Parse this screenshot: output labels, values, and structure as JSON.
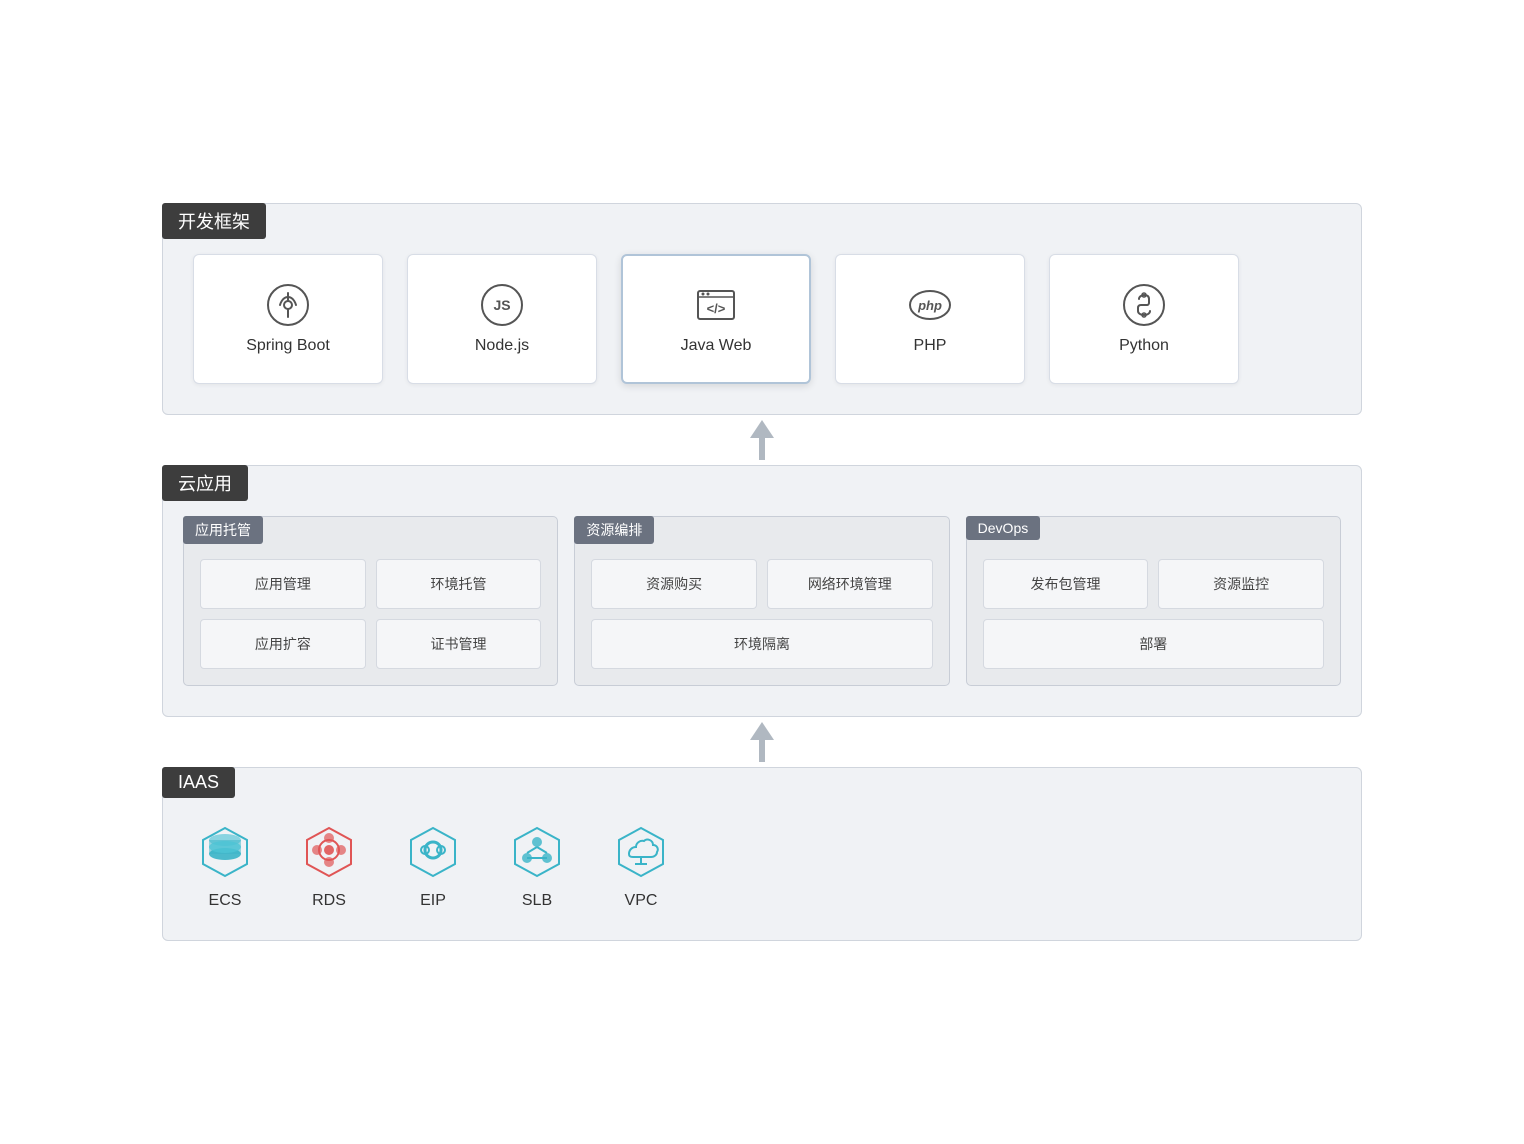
{
  "sections": {
    "dev": {
      "label": "开发框架",
      "frameworks": [
        {
          "id": "spring-boot",
          "name": "Spring Boot",
          "icon": "spring"
        },
        {
          "id": "nodejs",
          "name": "Node.js",
          "icon": "nodejs"
        },
        {
          "id": "java-web",
          "name": "Java Web",
          "icon": "javaweb",
          "highlighted": true
        },
        {
          "id": "php",
          "name": "PHP",
          "icon": "php"
        },
        {
          "id": "python",
          "name": "Python",
          "icon": "python"
        }
      ]
    },
    "cloud": {
      "label": "云应用",
      "subsections": [
        {
          "id": "app-hosting",
          "label": "应用托管",
          "cells": [
            {
              "text": "应用管理",
              "span": false
            },
            {
              "text": "环境托管",
              "span": false
            },
            {
              "text": "应用扩容",
              "span": false
            },
            {
              "text": "证书管理",
              "span": false
            }
          ]
        },
        {
          "id": "resource-arrange",
          "label": "资源编排",
          "cells": [
            {
              "text": "资源购买",
              "span": false
            },
            {
              "text": "网络环境管理",
              "span": false
            },
            {
              "text": "环境隔离",
              "span": true
            }
          ]
        },
        {
          "id": "devops",
          "label": "DevOps",
          "cells": [
            {
              "text": "发布包管理",
              "span": false
            },
            {
              "text": "资源监控",
              "span": false
            },
            {
              "text": "部署",
              "span": true
            }
          ]
        }
      ]
    },
    "iaas": {
      "label": "IAAS",
      "items": [
        {
          "id": "ecs",
          "name": "ECS",
          "icon": "ecs"
        },
        {
          "id": "rds",
          "name": "RDS",
          "icon": "rds"
        },
        {
          "id": "eip",
          "name": "EIP",
          "icon": "eip"
        },
        {
          "id": "slb",
          "name": "SLB",
          "icon": "slb"
        },
        {
          "id": "vpc",
          "name": "VPC",
          "icon": "vpc"
        }
      ]
    }
  },
  "colors": {
    "accent": "#3ab4c8",
    "dark_label": "#3d3d3d",
    "mid_label": "#6b7280",
    "border": "#d0d5dd",
    "bg": "#f0f2f5",
    "arrow": "#b0b8c1"
  }
}
